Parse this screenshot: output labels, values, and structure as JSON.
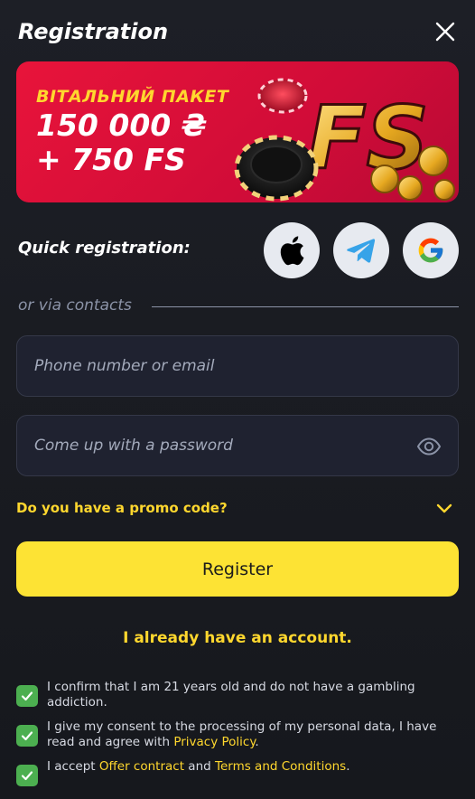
{
  "header": {
    "title": "Registration"
  },
  "banner": {
    "eyebrow": "ВІТАЛЬНИЙ ПАКЕТ",
    "line1": "150 000 ₴",
    "line2": "+ 750 FS",
    "art_text": "FS",
    "colors": {
      "background": "#e8143a",
      "eyebrow": "#ffd72e"
    }
  },
  "quick": {
    "label": "Quick registration:",
    "buttons": [
      {
        "icon": "apple-icon"
      },
      {
        "icon": "telegram-icon"
      },
      {
        "icon": "google-icon"
      }
    ]
  },
  "divider": {
    "label": "or via contacts"
  },
  "form": {
    "phone_placeholder": "Phone number or email",
    "password_placeholder": "Come up with a password",
    "password_icon": "eye-icon"
  },
  "promo": {
    "label": "Do you have a promo code?",
    "icon": "chevron-down-icon"
  },
  "register": {
    "label": "Register"
  },
  "login": {
    "label": "I already have an account."
  },
  "consents": [
    {
      "checked": true,
      "text": "I confirm that I am 21 years old and do not have a gambling addiction."
    },
    {
      "checked": true,
      "text_before": "I give my consent to the processing of my personal data, I have read and agree with ",
      "link": "Privacy Policy",
      "text_after": "."
    },
    {
      "checked": true,
      "text_before": "I accept ",
      "link1": "Offer contract",
      "text_middle": " and ",
      "link2": "Terms and Conditions",
      "text_after": "."
    }
  ],
  "colors": {
    "accent": "#ffd72e",
    "button": "#fde334",
    "check": "#4caf50",
    "background": "#1b1d23"
  }
}
